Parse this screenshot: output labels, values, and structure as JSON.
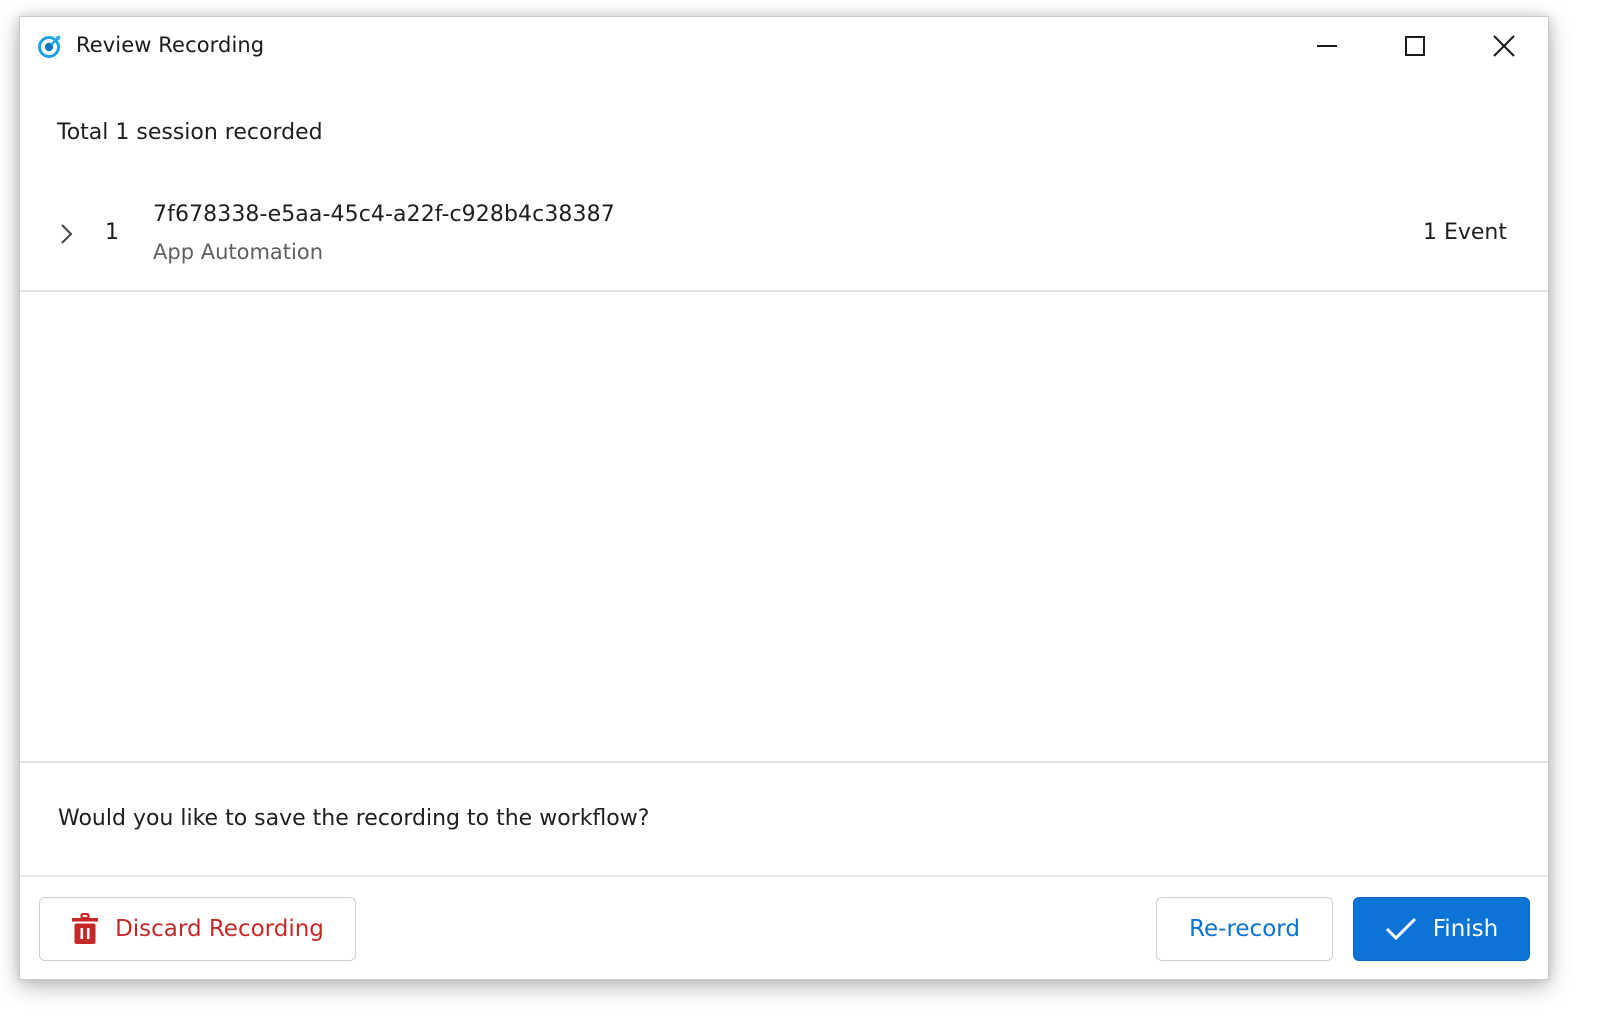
{
  "window": {
    "title": "Review Recording",
    "app_icon": "target-record-icon",
    "controls": {
      "minimize": "minimize-icon",
      "maximize": "maximize-icon",
      "close": "close-icon"
    }
  },
  "summary": {
    "text": "Total 1 session recorded"
  },
  "sessions": [
    {
      "index": "1",
      "id": "7f678338-e5aa-45c4-a22f-c928b4c38387",
      "type": "App Automation",
      "events": "1 Event",
      "expanded": false
    }
  ],
  "prompt": {
    "question": "Would you like to save the recording to the workflow?"
  },
  "footer": {
    "discard_label": "Discard Recording",
    "rerecord_label": "Re-record",
    "finish_label": "Finish"
  },
  "colors": {
    "accent": "#0b74d5",
    "danger": "#c62828",
    "icon_blue": "#1fa3e0"
  }
}
